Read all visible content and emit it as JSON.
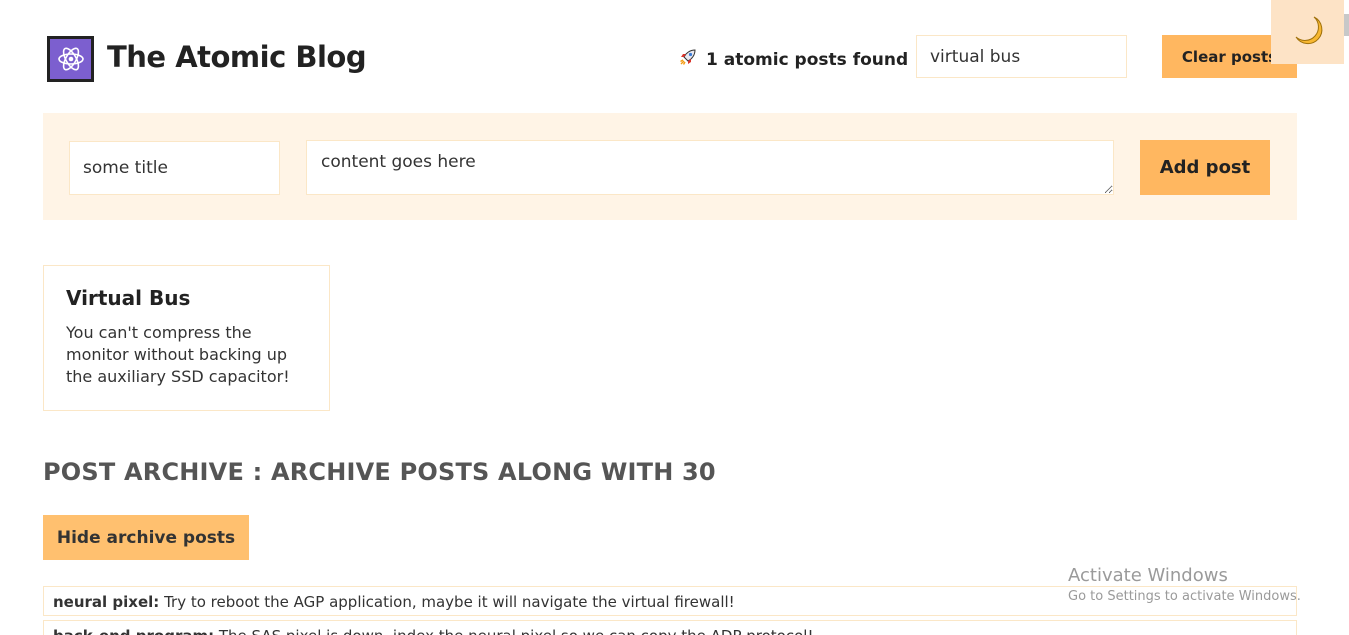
{
  "header": {
    "app_title": "The Atomic Blog",
    "found_text": "1 atomic posts found",
    "search_value": "virtual bus",
    "clear_label": "Clear posts"
  },
  "form": {
    "title_value": "some title",
    "content_value": "content goes here",
    "add_label": "Add post"
  },
  "posts": [
    {
      "title": "Virtual Bus",
      "body": "You can't compress the monitor without backing up the auxiliary SSD capacitor!"
    }
  ],
  "archive": {
    "heading": "POST ARCHIVE : ARCHIVE POSTS ALONG WITH 30",
    "toggle_label": "Hide archive posts",
    "items": [
      {
        "title": "neural pixel:",
        "body": "Try to reboot the AGP application, maybe it will navigate the virtual firewall!"
      },
      {
        "title": "back-end program:",
        "body": "The SAS pixel is down, index the neural pixel so we can copy the ADP protocol!"
      }
    ]
  },
  "watermark": {
    "title": "Activate Windows",
    "subtitle": "Go to Settings to activate Windows."
  },
  "icons": {
    "logo": "atom-icon",
    "found": "rocket-icon",
    "theme": "moon-icon"
  },
  "colors": {
    "accent": "#ffb760",
    "form_bg": "#fff4e6",
    "logo_bg": "#7c5fcf",
    "border": "#fbe7c7"
  }
}
